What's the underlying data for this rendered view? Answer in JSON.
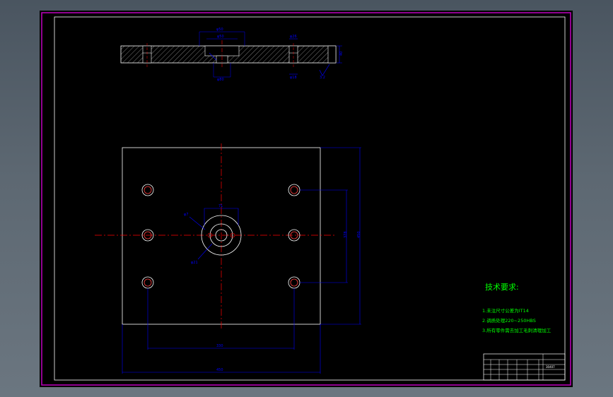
{
  "canvas": {
    "background": "#000000",
    "frame_color": "#c000c0",
    "border_color": "#ffffff",
    "centerline_color": "#ff0000",
    "dimension_color": "#0000ff",
    "note_color": "#00ff00",
    "hatch_color": "#ffffff"
  },
  "section_view": {
    "dims": {
      "d_outer": "φ50",
      "d_mid": "φ50",
      "d_bottom": "φ80",
      "d_hole_top": "φ26",
      "d_hole_bottom": "φ18",
      "thickness": "40",
      "roughness": "3.2"
    }
  },
  "plan_view": {
    "dims": {
      "center_label": "71",
      "hole_label": "φ7",
      "bore_label": "φ21",
      "height_inner": "378",
      "height_outer": "450",
      "width_inner": "330",
      "width_outer": "450"
    }
  },
  "notes": {
    "title": "技术要求:",
    "lines": [
      "1.未注尺寸公差为IT14",
      "2.调质处理220~250HBS",
      "3.所有零件需去加工毛刺清理加工"
    ]
  },
  "title_block": {
    "drawing_no": "30407"
  }
}
